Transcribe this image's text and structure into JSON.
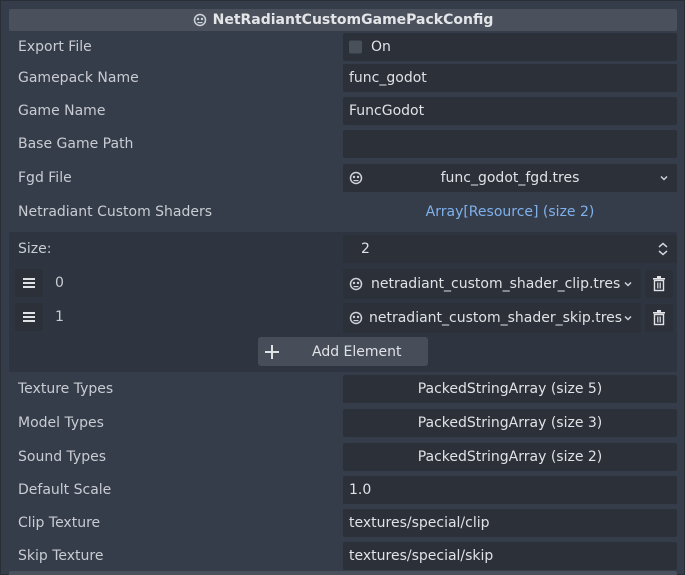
{
  "header": {
    "title": "NetRadiantCustomGamePackConfig",
    "icon": "resource-icon"
  },
  "properties": {
    "export_file": {
      "label": "Export File",
      "checkbox_label": "On",
      "checked": false
    },
    "gamepack_name": {
      "label": "Gamepack Name",
      "value": "func_godot"
    },
    "game_name": {
      "label": "Game Name",
      "value": "FuncGodot"
    },
    "base_game_path": {
      "label": "Base Game Path",
      "value": ""
    },
    "fgd_file": {
      "label": "Fgd File",
      "value": "func_godot_fgd.tres"
    },
    "custom_shaders": {
      "label": "Netradiant Custom Shaders",
      "value": "Array[Resource] (size 2)"
    },
    "texture_types": {
      "label": "Texture Types",
      "value": "PackedStringArray (size 5)"
    },
    "model_types": {
      "label": "Model Types",
      "value": "PackedStringArray (size 3)"
    },
    "sound_types": {
      "label": "Sound Types",
      "value": "PackedStringArray (size 2)"
    },
    "default_scale": {
      "label": "Default Scale",
      "value": "1.0"
    },
    "clip_texture": {
      "label": "Clip Texture",
      "value": "textures/special/clip"
    },
    "skip_texture": {
      "label": "Skip Texture",
      "value": "textures/special/skip"
    }
  },
  "array_editor": {
    "size_label": "Size:",
    "size_value": "2",
    "items": [
      {
        "index": "0",
        "value": "netradiant_custom_shader_clip.tres"
      },
      {
        "index": "1",
        "value": "netradiant_custom_shader_skip.tres"
      }
    ],
    "add_label": "Add Element"
  },
  "colors": {
    "link": "#7fb1ec",
    "field_bg": "#2b3039",
    "panel_bg": "#363d4a"
  }
}
